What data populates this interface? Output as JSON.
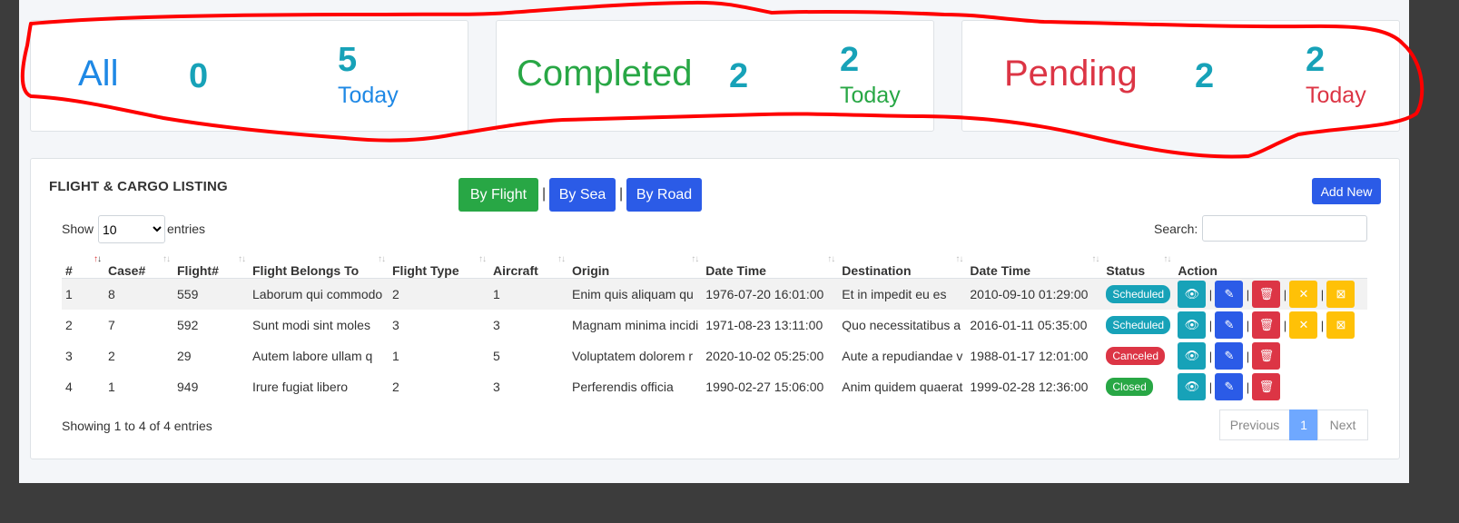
{
  "stats": [
    {
      "label": "All",
      "total": "0",
      "today_count": "5",
      "today_label": "Today",
      "color": "#1e88e5"
    },
    {
      "label": "Completed",
      "total": "2",
      "today_count": "2",
      "today_label": "Today",
      "color": "#28a745"
    },
    {
      "label": "Pending",
      "total": "2",
      "today_count": "2",
      "today_label": "Today",
      "color": "#dc3545"
    }
  ],
  "listing": {
    "title": "FLIGHT & CARGO LISTING",
    "filters": [
      "By Flight",
      "By Sea",
      "By Road"
    ],
    "filter_separator": "|",
    "add_new_label": "Add New",
    "show_label": "Show",
    "entries_value": "10",
    "entries_label": "entries",
    "search_label": "Search:",
    "search_value": "",
    "columns": [
      "#",
      "Case#",
      "Flight#",
      "Flight Belongs To",
      "Flight Type",
      "Aircraft",
      "Origin",
      "Date Time",
      "Destination",
      "Date Time",
      "Status",
      "Action"
    ],
    "rows": [
      {
        "num": "1",
        "case": "8",
        "flight": "559",
        "belongs": "Laborum qui commodo",
        "type": "2",
        "aircraft": "1",
        "origin": "Enim quis aliquam qu",
        "origin_time": "1976-07-20 16:01:00",
        "destination": "Et in impedit eu es",
        "dest_time": "2010-09-10 01:29:00",
        "status": "Scheduled",
        "status_color": "#17a2b8"
      },
      {
        "num": "2",
        "case": "7",
        "flight": "592",
        "belongs": "Sunt modi sint moles",
        "type": "3",
        "aircraft": "3",
        "origin": "Magnam minima incidi",
        "origin_time": "1971-08-23 13:11:00",
        "destination": "Quo necessitatibus a",
        "dest_time": "2016-01-11 05:35:00",
        "status": "Scheduled",
        "status_color": "#17a2b8"
      },
      {
        "num": "3",
        "case": "2",
        "flight": "29",
        "belongs": "Autem labore ullam q",
        "type": "1",
        "aircraft": "5",
        "origin": "Voluptatem dolorem r",
        "origin_time": "2020-10-02 05:25:00",
        "destination": "Aute a repudiandae v",
        "dest_time": "1988-01-17 12:01:00",
        "status": "Canceled",
        "status_color": "#dc3545"
      },
      {
        "num": "4",
        "case": "1",
        "flight": "949",
        "belongs": "Irure fugiat libero",
        "type": "2",
        "aircraft": "3",
        "origin": "Perferendis officia",
        "origin_time": "1990-02-27 15:06:00",
        "destination": "Anim quidem quaerat",
        "dest_time": "1999-02-28 12:36:00",
        "status": "Closed",
        "status_color": "#28a745"
      }
    ],
    "info_text": "Showing 1 to 4 of 4 entries",
    "pagination": {
      "previous": "Previous",
      "current": "1",
      "next": "Next"
    }
  },
  "icons": {
    "view": "eye-icon",
    "edit": "edit-icon",
    "delete": "trash-icon",
    "cancel": "x-icon",
    "close": "square-x-icon"
  },
  "annotation_color": "#ff0000"
}
